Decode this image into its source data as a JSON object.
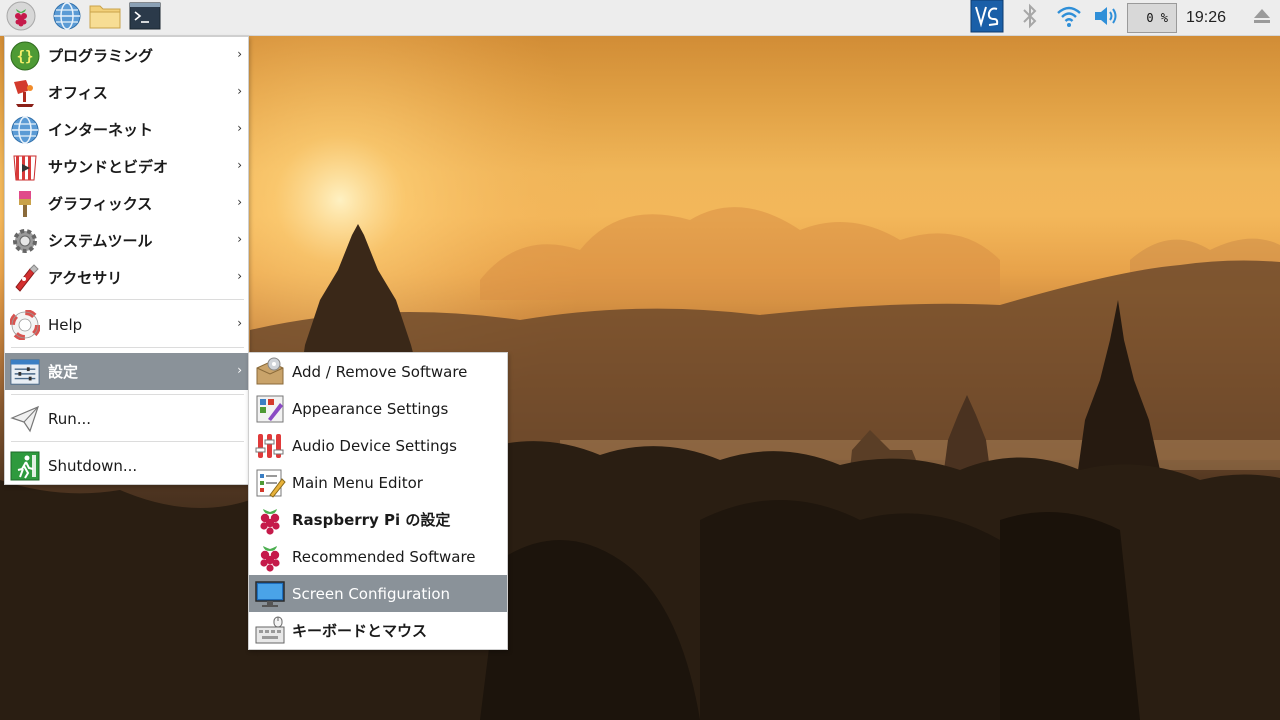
{
  "taskbar": {
    "launchers": [
      {
        "icon": "raspberry-menu-icon",
        "tooltip": ""
      },
      {
        "icon": "globe-browser-icon",
        "tooltip": ""
      },
      {
        "icon": "folder-icon",
        "tooltip": ""
      },
      {
        "icon": "terminal-icon",
        "tooltip": ""
      }
    ],
    "tray": {
      "vnc_icon": "vnc-icon",
      "bluetooth_icon": "bluetooth-icon",
      "wifi_icon": "wifi-icon",
      "volume_icon": "volume-icon",
      "cpu_usage": "0 %",
      "clock": "19:26",
      "eject_icon": "eject-icon"
    }
  },
  "menu": {
    "items": [
      {
        "label": "プログラミング",
        "icon": "programming-icon",
        "has_submenu": true
      },
      {
        "label": "オフィス",
        "icon": "office-icon",
        "has_submenu": true
      },
      {
        "label": "インターネット",
        "icon": "internet-icon",
        "has_submenu": true
      },
      {
        "label": "サウンドとビデオ",
        "icon": "sound-video-icon",
        "has_submenu": true
      },
      {
        "label": "グラフィックス",
        "icon": "graphics-icon",
        "has_submenu": true
      },
      {
        "label": "システムツール",
        "icon": "system-tools-icon",
        "has_submenu": true
      },
      {
        "label": "アクセサリ",
        "icon": "accessories-icon",
        "has_submenu": true
      },
      {
        "label": "Help",
        "icon": "help-icon",
        "has_submenu": true
      },
      {
        "label": "設定",
        "icon": "preferences-icon",
        "has_submenu": true,
        "selected": true
      },
      {
        "label": "Run...",
        "icon": "run-icon",
        "has_submenu": false
      },
      {
        "label": "Shutdown...",
        "icon": "shutdown-icon",
        "has_submenu": false
      }
    ],
    "arrow": "›"
  },
  "submenu": {
    "items": [
      {
        "label": "Add / Remove Software",
        "icon": "package-icon"
      },
      {
        "label": "Appearance Settings",
        "icon": "appearance-icon"
      },
      {
        "label": "Audio Device Settings",
        "icon": "audio-mixer-icon"
      },
      {
        "label": "Main Menu Editor",
        "icon": "menu-editor-icon"
      },
      {
        "label": "Raspberry Pi の設定",
        "icon": "raspberry-config-icon"
      },
      {
        "label": "Recommended Software",
        "icon": "raspberry-recommended-icon"
      },
      {
        "label": "Screen Configuration",
        "icon": "monitor-icon",
        "selected": true
      },
      {
        "label": "キーボードとマウス",
        "icon": "keyboard-mouse-icon"
      }
    ]
  },
  "colors": {
    "panel": "#ededed",
    "selection": "#8a9299",
    "vnc": "#1a5fa8"
  }
}
